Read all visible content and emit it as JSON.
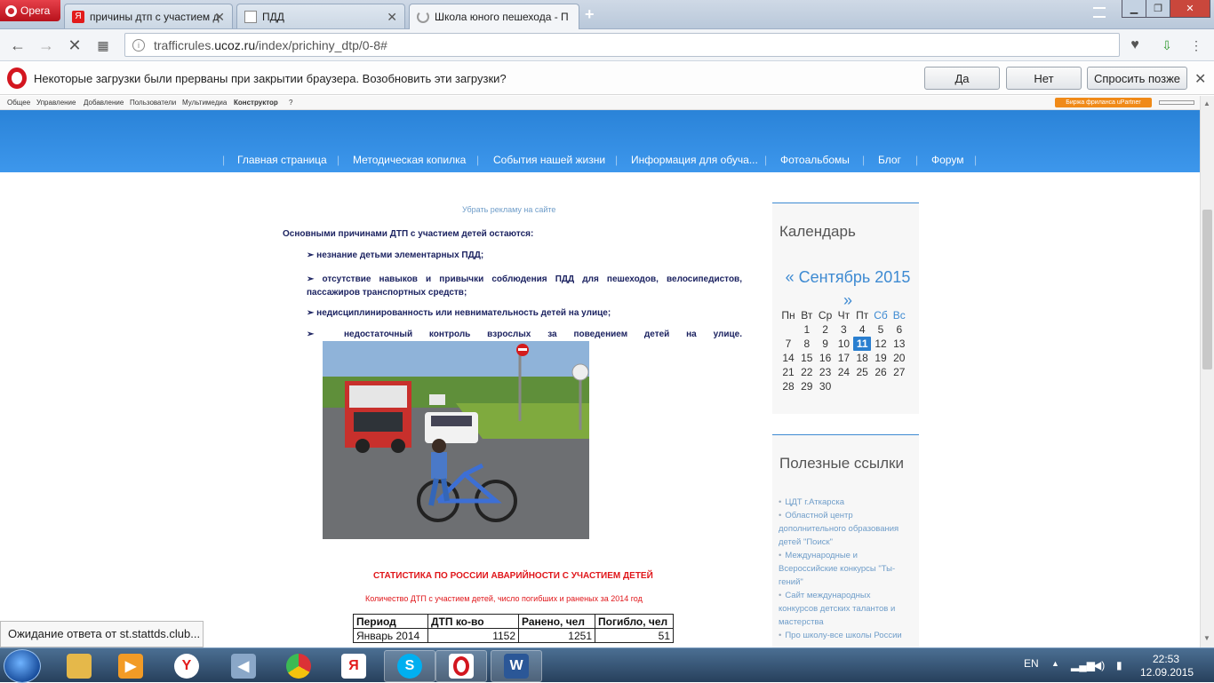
{
  "browser": {
    "menu_label": "Opera",
    "tabs": [
      {
        "title": "причины дтп с участием д",
        "favicon": "yandex-icon"
      },
      {
        "title": "ПДД",
        "favicon": "page-icon"
      },
      {
        "title": "Школа юного пешехода - П",
        "favicon": "loading-icon"
      }
    ],
    "new_tab_label": "+",
    "url_prefix": "trafficrules.",
    "url_domain": "ucoz.ru",
    "url_path": "/index/prichiny_dtp/0-8#"
  },
  "notification": {
    "text": "Некоторые загрузки были прерваны при закрытии браузера. Возобновить эти загрузки?",
    "yes": "Да",
    "no": "Нет",
    "later": "Спросить позже"
  },
  "ucoz_panel": {
    "items": [
      "Общее",
      "Управление",
      "Добавление",
      "Пользователи",
      "Мультимедиа",
      "Конструктор",
      "?"
    ],
    "partner": "Биржа фриланса uPartner"
  },
  "site_menu": [
    "Главная страница",
    "Методическая копилка",
    "События нашей жизни",
    "Информация для обуча...",
    "Фотоальбомы",
    "Блог",
    "Форум"
  ],
  "content": {
    "remove_ads": "Убрать рекламу на сайте",
    "intro": "Основными причинами ДТП с участием детей остаются:",
    "bullets": [
      "незнание детьми элементарных  ПДД;",
      "отсутствие навыков и привычки соблюдения ПДД для пешеходов, велосипедистов, пассажиров транспортных средств;",
      "недисциплинированность или невнимательность детей на улице;",
      "недостаточный контроль взрослых за поведением детей на улице."
    ],
    "stats_title": "СТАТИСТИКА ПО РОССИИ АВАРИЙНОСТИ С УЧАСТИЕМ ДЕТЕЙ",
    "stats_subtitle": "Количество ДТП с участием детей, число погибших и раненых за 2014 год",
    "table": {
      "headers": [
        "Период",
        "ДТП ко-во",
        "Ранено, чел",
        "Погибло, чел"
      ],
      "rows": [
        [
          "Январь 2014",
          "1152",
          "1251",
          "51"
        ]
      ]
    }
  },
  "sidebar": {
    "calendar_title": "Календарь",
    "calendar_month": "« Сентябрь 2015 »",
    "weekdays": [
      "Пн",
      "Вт",
      "Ср",
      "Чт",
      "Пт",
      "Сб",
      "Вс"
    ],
    "days": [
      "",
      "1",
      "2",
      "3",
      "4",
      "5",
      "6",
      "7",
      "8",
      "9",
      "10",
      "11",
      "12",
      "13",
      "14",
      "15",
      "16",
      "17",
      "18",
      "19",
      "20",
      "21",
      "22",
      "23",
      "24",
      "25",
      "26",
      "27",
      "28",
      "29",
      "30"
    ],
    "today": "11",
    "links_title": "Полезные ссылки",
    "links": [
      "ЦДТ г.Аткарска",
      "Областной центр дополнительного образования детей \"Поиск\"",
      "Международные и Всероссийские конкурсы \"Ты-гений\"",
      "Сайт международных конкурсов детских талантов и мастерства",
      "Про школу-все школы России"
    ]
  },
  "status_text": "Ожидание ответа от st.stattds.club...",
  "taskbar": {
    "lang": "EN",
    "time": "22:53",
    "date": "12.09.2015"
  }
}
